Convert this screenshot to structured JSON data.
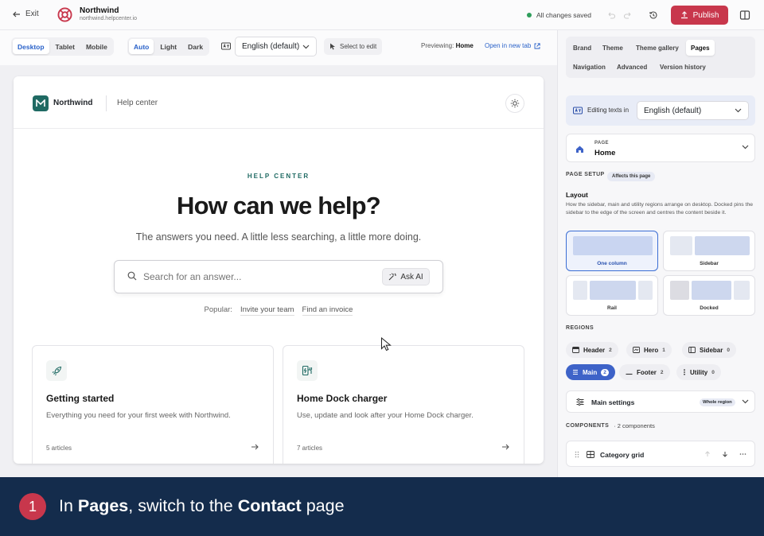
{
  "topbar": {
    "exit_label": "Exit",
    "brand_name": "Northwind",
    "brand_url": "northwind.helpcenter.io",
    "save_status": "All changes saved",
    "publish_label": "Publish",
    "colors": {
      "publish": "#c8374c",
      "saved_dot": "#2e9e5b"
    }
  },
  "toolbar": {
    "devices": [
      "Desktop",
      "Tablet",
      "Mobile"
    ],
    "device_selected": "Desktop",
    "modes": [
      "Auto",
      "Light",
      "Dark"
    ],
    "mode_selected": "Auto",
    "language": "English (default)",
    "select_to_edit": "Select to edit",
    "previewing_label": "Previewing:",
    "previewing_page": "Home",
    "open_new_tab": "Open in new tab"
  },
  "preview": {
    "brand": "Northwind",
    "section": "Help center",
    "kicker": "HELP CENTER",
    "headline": "How can we help?",
    "lead": "The answers you need. A little less searching, a little more doing.",
    "search_placeholder": "Search for an answer...",
    "ask_ai": "Ask AI",
    "popular_label": "Popular:",
    "popular_links": [
      "Invite your team",
      "Find an invoice"
    ],
    "cards": [
      {
        "icon": "rocket-icon",
        "title": "Getting started",
        "desc": "Everything you need for your first week with Northwind.",
        "meta": "5 articles"
      },
      {
        "icon": "charger-icon",
        "title": "Home Dock charger",
        "desc": "Use, update and look after your Home Dock charger.",
        "meta": "7 articles"
      }
    ],
    "brand_color": "#1f6a63"
  },
  "panel": {
    "tabs": [
      "Brand",
      "Theme",
      "Theme gallery",
      "Pages",
      "Navigation",
      "Advanced",
      "Version history"
    ],
    "tab_selected": "Pages",
    "editing_label": "Editing texts in",
    "editing_language": "English (default)",
    "page_caption": "PAGE",
    "page_value": "Home",
    "page_setup": "PAGE SETUP",
    "affects": "Affects this page",
    "layout_title": "Layout",
    "layout_desc": "How the sidebar, main and utility regions arrange on desktop. Docked pins the sidebar to the edge of the screen and centres the content beside it.",
    "layouts": [
      "One column",
      "Sidebar",
      "Rail",
      "Docked"
    ],
    "layout_selected": "One column",
    "regions_label": "REGIONS",
    "regions": [
      {
        "name": "Header",
        "count": "2"
      },
      {
        "name": "Hero",
        "count": "1"
      },
      {
        "name": "Sidebar",
        "count": "0"
      },
      {
        "name": "Main",
        "count": "2"
      },
      {
        "name": "Footer",
        "count": "2"
      },
      {
        "name": "Utility",
        "count": "0"
      }
    ],
    "region_selected": "Main",
    "main_settings": "Main settings",
    "whole_region": "Whole region",
    "components_label": "COMPONENTS",
    "components_count": "· 2 components",
    "component_name": "Category grid",
    "accent": "#3e63c8"
  },
  "banner": {
    "step": "1",
    "text_pre": "In ",
    "text_b1": "Pages",
    "text_mid": ", switch to the ",
    "text_b2": "Contact",
    "text_post": " page",
    "bg": "#142c4c"
  }
}
